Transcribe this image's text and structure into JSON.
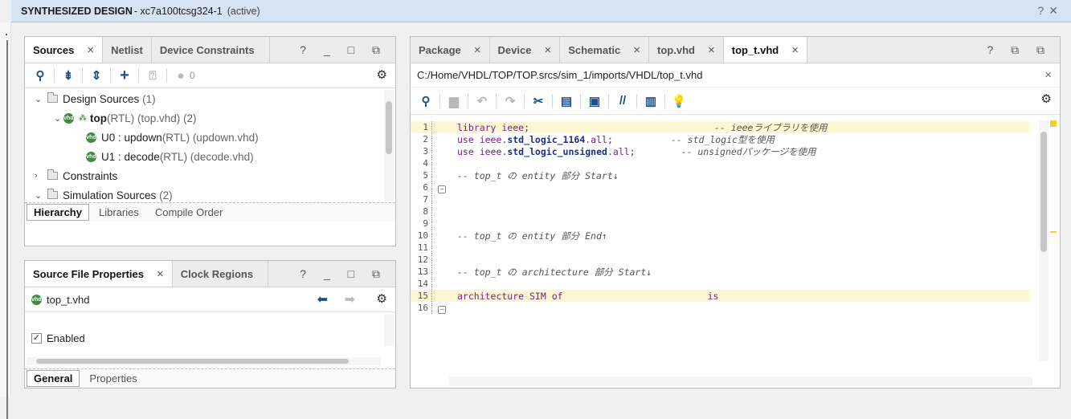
{
  "banner": {
    "title": "SYNTHESIZED DESIGN",
    "device": " - xc7a100tcsg324-1",
    "status": "(active)",
    "help": "?",
    "close": "✕"
  },
  "sources_panel": {
    "tabs": [
      {
        "label": "Sources",
        "close": "×"
      },
      {
        "label": "Netlist"
      },
      {
        "label": "Device Constraints"
      }
    ],
    "controls": "? _ □ ⧉",
    "toolbar": {
      "count": "0"
    },
    "tree": {
      "design_sources": "Design Sources",
      "design_sources_count": "(1)",
      "top_name": "top",
      "top_detail": "(RTL) (top.vhd) (2)",
      "u0_name": "U0 : updown",
      "u0_detail": "(RTL) (updown.vhd)",
      "u1_name": "U1 : decode",
      "u1_detail": "(RTL) (decode.vhd)",
      "constraints": "Constraints",
      "sim_sources": "Simulation Sources",
      "sim_sources_count": "(2)"
    },
    "bottom_tabs": [
      "Hierarchy",
      "Libraries",
      "Compile Order"
    ]
  },
  "props_panel": {
    "tabs": [
      {
        "label": "Source File Properties",
        "close": "×"
      },
      {
        "label": "Clock Regions"
      }
    ],
    "controls": "? _ □ ⧉",
    "file": "top_t.vhd",
    "enabled_label": "Enabled",
    "bottom_tabs": [
      "General",
      "Properties"
    ]
  },
  "editor": {
    "tabs": [
      {
        "label": "Package",
        "close": "×"
      },
      {
        "label": "Device",
        "close": "×"
      },
      {
        "label": "Schematic",
        "close": "×"
      },
      {
        "label": "top.vhd",
        "close": "×"
      },
      {
        "label": "top_t.vhd",
        "close": "×"
      }
    ],
    "controls": "? ⧉ ⧉",
    "path": "C:/Home/VHDL/TOP/TOP.srcs/sim_1/imports/VHDL/top_t.vhd",
    "path_close": "×",
    "lines": [
      {
        "n": "1",
        "a": "library ieee;",
        "c": "-- ieeeライブラリを使用"
      },
      {
        "n": "2",
        "a": "use ieee.",
        "b": "std_logic_1164",
        "d": ".all;",
        "c": "-- std_logic型を使用"
      },
      {
        "n": "3",
        "a": "use ieee.",
        "b": "std_logic_unsigned",
        "d": ".all;",
        "c": "-- unsignedパッケージを使用"
      },
      {
        "n": "4"
      },
      {
        "n": "5",
        "c": "-- top_t の entity 部分 Start↓"
      },
      {
        "n": "6"
      },
      {
        "n": "7"
      },
      {
        "n": "8"
      },
      {
        "n": "9"
      },
      {
        "n": "10",
        "c": "-- top_t の entity 部分 End↑"
      },
      {
        "n": "11"
      },
      {
        "n": "12"
      },
      {
        "n": "13",
        "c": "-- top_t の architecture 部分 Start↓"
      },
      {
        "n": "14"
      },
      {
        "n": "15",
        "a": "architecture SIM of",
        "e": "is"
      },
      {
        "n": "16"
      }
    ]
  },
  "colors": {
    "accent": "#1f4d8a",
    "banner": "#d6e3f3",
    "highlight": "#fdf6d2",
    "keyword": "#7a1f86"
  }
}
